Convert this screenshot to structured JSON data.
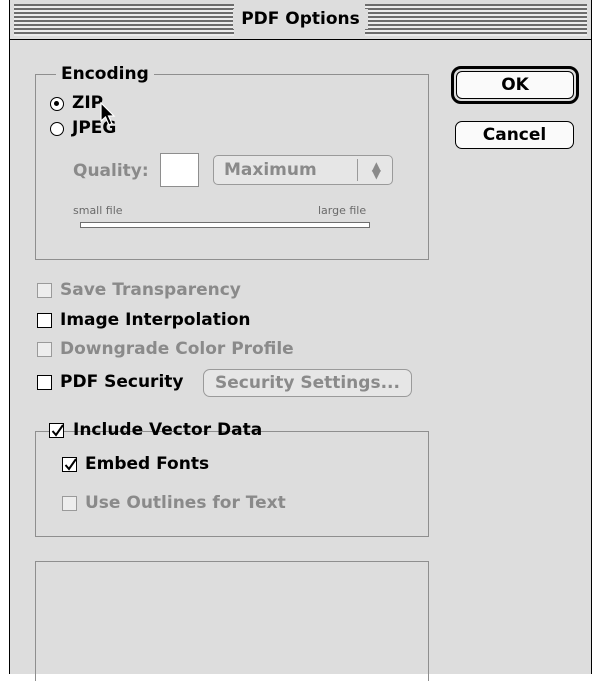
{
  "window": {
    "title": "PDF Options"
  },
  "encoding": {
    "label": "Encoding",
    "options": [
      {
        "label": "ZIP",
        "selected": true
      },
      {
        "label": "JPEG",
        "selected": false
      }
    ],
    "quality_label": "Quality:",
    "quality_value": "",
    "quality_preset": "Maximum",
    "slider_min_label": "small file",
    "slider_max_label": "large file"
  },
  "options": {
    "save_transparency": {
      "label": "Save Transparency",
      "checked": false,
      "enabled": false
    },
    "image_interpolation": {
      "label": "Image Interpolation",
      "checked": false,
      "enabled": true
    },
    "downgrade_color_profile": {
      "label": "Downgrade Color Profile",
      "checked": false,
      "enabled": false
    },
    "pdf_security": {
      "label": "PDF Security",
      "checked": false,
      "enabled": true
    },
    "security_settings_label": "Security Settings..."
  },
  "vector": {
    "include_vector_data": {
      "label": "Include Vector Data",
      "checked": true
    },
    "embed_fonts": {
      "label": "Embed Fonts",
      "checked": true
    },
    "use_outlines": {
      "label": "Use Outlines for Text",
      "checked": false,
      "enabled": false
    }
  },
  "buttons": {
    "ok": "OK",
    "cancel": "Cancel"
  },
  "icons": {
    "check": "check-mark-icon",
    "popup_arrows": "up-down-arrows-icon",
    "cursor": "mouse-pointer-icon"
  }
}
